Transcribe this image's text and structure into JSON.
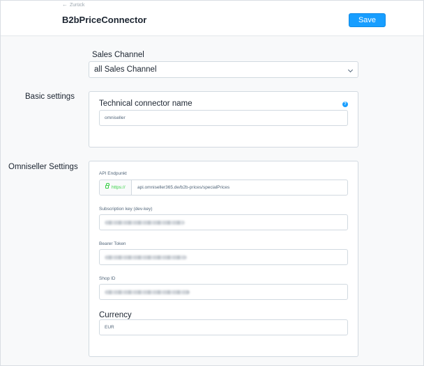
{
  "header": {
    "back_label": "Zurück",
    "title": "B2bPriceConnector",
    "save_label": "Save"
  },
  "sales_channel": {
    "label": "Sales Channel",
    "selected": "all Sales Channel"
  },
  "basic_settings": {
    "section_label": "Basic settings",
    "connector_name_label": "Technical connector name",
    "connector_name_value": "omniseller",
    "help_icon": "help-circle-icon"
  },
  "omniseller_settings": {
    "section_label": "Omniseller Settings",
    "api_endpoint_label": "API Endpunkt",
    "api_endpoint_prefix": "https://",
    "api_endpoint_value": "api.omniseller365.de/b2b-prices/specialPrices",
    "subscription_key_label": "Subscription key (dev-key)",
    "bearer_token_label": "Bearer Token",
    "shop_id_label": "Shop ID",
    "currency_label": "Currency",
    "currency_value": "EUR"
  },
  "colors": {
    "primary": "#189eff",
    "secure_green": "#37d046"
  }
}
